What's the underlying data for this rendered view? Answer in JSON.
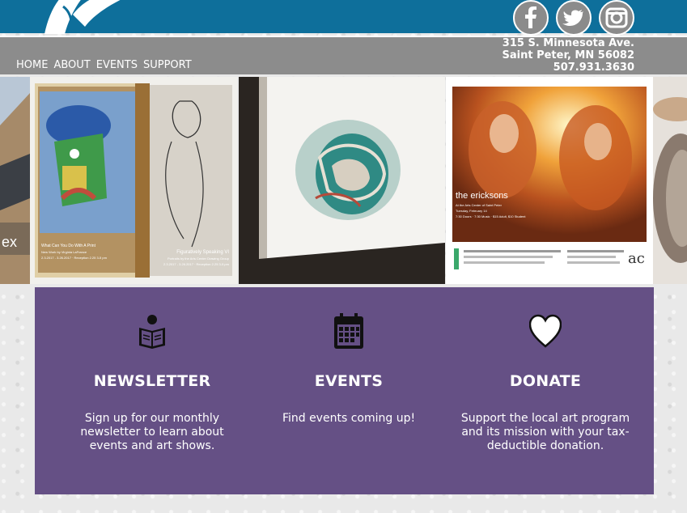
{
  "header": {
    "address_line1": "315 S. Minnesota Ave.",
    "address_line2": "Saint Peter, MN 56082",
    "phone": "507.931.3630",
    "social": [
      "facebook-icon",
      "twitter-icon",
      "instagram-icon"
    ]
  },
  "nav": {
    "items": [
      {
        "label": "HOME"
      },
      {
        "label": "ABOUT"
      },
      {
        "label": "EVENTS"
      },
      {
        "label": "SUPPORT"
      }
    ]
  },
  "gallery": {
    "tile1": {
      "left_title": "What Can You Do With A Print",
      "left_sub": "New Work by Virginia LaFrance",
      "left_dates": "2.3.2017 - 3.26.2017 · Reception 2.25 3-5 pm",
      "right_title": "Figuratively Speaking VI",
      "right_sub": "Portraits by the Arts Center Drawing Group",
      "right_dates": "2.3.2017 - 3.26.2017 · Reception 2.25 3-5 pm"
    },
    "tile3": {
      "band": "the ericksons",
      "line1": "At the Arts Center of Saint Peter",
      "line2": "Tuesday, February 14",
      "line3": "7:30 Doors · 7:30 Music · $15 Adult, $10 Student"
    }
  },
  "features": [
    {
      "title": "NEWSLETTER",
      "text": "Sign up for our monthly newsletter to learn about events and art shows.",
      "icon": "reading-book-icon"
    },
    {
      "title": "EVENTS",
      "text": "Find events coming up!",
      "icon": "calendar-icon"
    },
    {
      "title": "DONATE",
      "text": "Support the local art program and its mission with your tax-deductible donation.",
      "icon": "heart-icon"
    }
  ],
  "colors": {
    "topbar": "#0e6f9b",
    "navbar": "#8c8c8c",
    "panel": "#655085"
  }
}
